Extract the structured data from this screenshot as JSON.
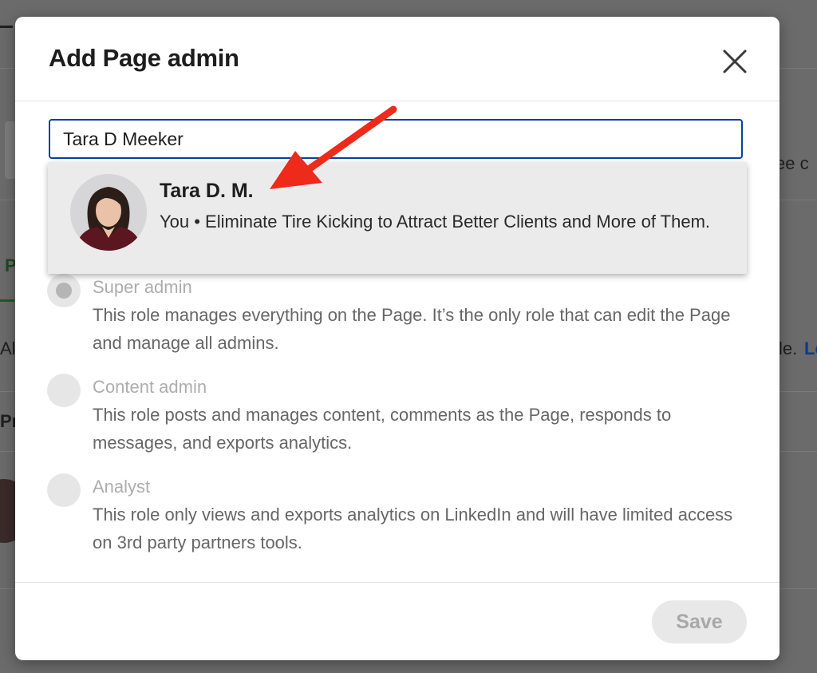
{
  "modal": {
    "title": "Add Page admin",
    "search": {
      "value": "Tara D Meeker",
      "placeholder": ""
    }
  },
  "search_result": {
    "name": "Tara D. M.",
    "subtitle": "You • Eliminate Tire Kicking to Attract Better Clients and More of Them."
  },
  "roles": [
    {
      "label": "Super admin",
      "description": "This role manages everything on the Page. It’s the only role that can edit the Page and manage all admins.",
      "selected": true
    },
    {
      "label": "Content admin",
      "description": "This role posts and manages content, comments as the Page, responds to messages, and exports analytics.",
      "selected": false
    },
    {
      "label": "Analyst",
      "description": "This role only views and exports analytics on LinkedIn and will have limited access on 3rd party partners tools.",
      "selected": false
    }
  ],
  "footer": {
    "save_label": "Save"
  },
  "background_page": {
    "fragments": [
      "ee c",
      "P",
      "Al",
      "le.",
      "Le",
      "Pr"
    ]
  },
  "colors": {
    "focus_border": "#0a3fa6",
    "annotation_arrow": "#ee2a1a",
    "disabled_button": "#e8e8e8"
  }
}
